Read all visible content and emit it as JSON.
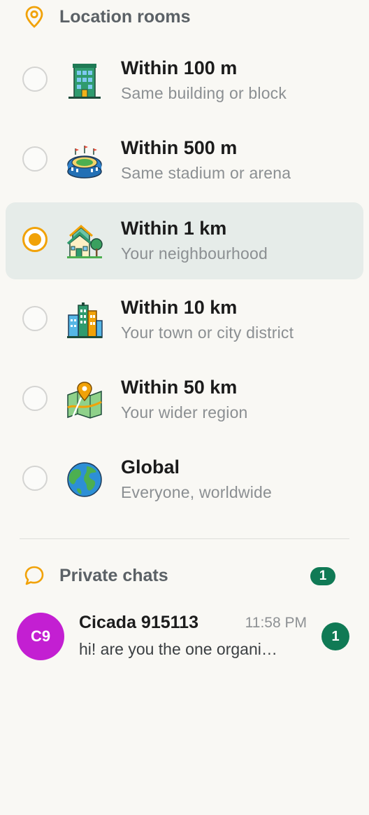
{
  "location_section": {
    "title": "Location rooms",
    "icon": "location-pin-icon",
    "accent": "#f1a208"
  },
  "rooms": [
    {
      "title": "Within 100 m",
      "subtitle": "Same building or block",
      "icon": "building-icon",
      "selected": false
    },
    {
      "title": "Within 500 m",
      "subtitle": "Same stadium or arena",
      "icon": "stadium-icon",
      "selected": false
    },
    {
      "title": "Within 1 km",
      "subtitle": "Your neighbourhood",
      "icon": "neighbourhood-icon",
      "selected": true
    },
    {
      "title": "Within 10 km",
      "subtitle": "Your town or city district",
      "icon": "city-icon",
      "selected": false
    },
    {
      "title": "Within 50 km",
      "subtitle": "Your wider region",
      "icon": "map-icon",
      "selected": false
    },
    {
      "title": "Global",
      "subtitle": "Everyone, worldwide",
      "icon": "globe-icon",
      "selected": false
    }
  ],
  "private_section": {
    "title": "Private chats",
    "icon": "chat-bubble-icon",
    "count": "1"
  },
  "chats": [
    {
      "avatar": "C9",
      "avatar_color": "#c31fd2",
      "name": "Cicada 915113",
      "time": "11:58 PM",
      "preview": "hi! are you the one organi…",
      "unread": "1"
    }
  ],
  "colors": {
    "selected_bg": "#e6ece9",
    "badge": "#107a55",
    "background": "#f9f8f4"
  }
}
